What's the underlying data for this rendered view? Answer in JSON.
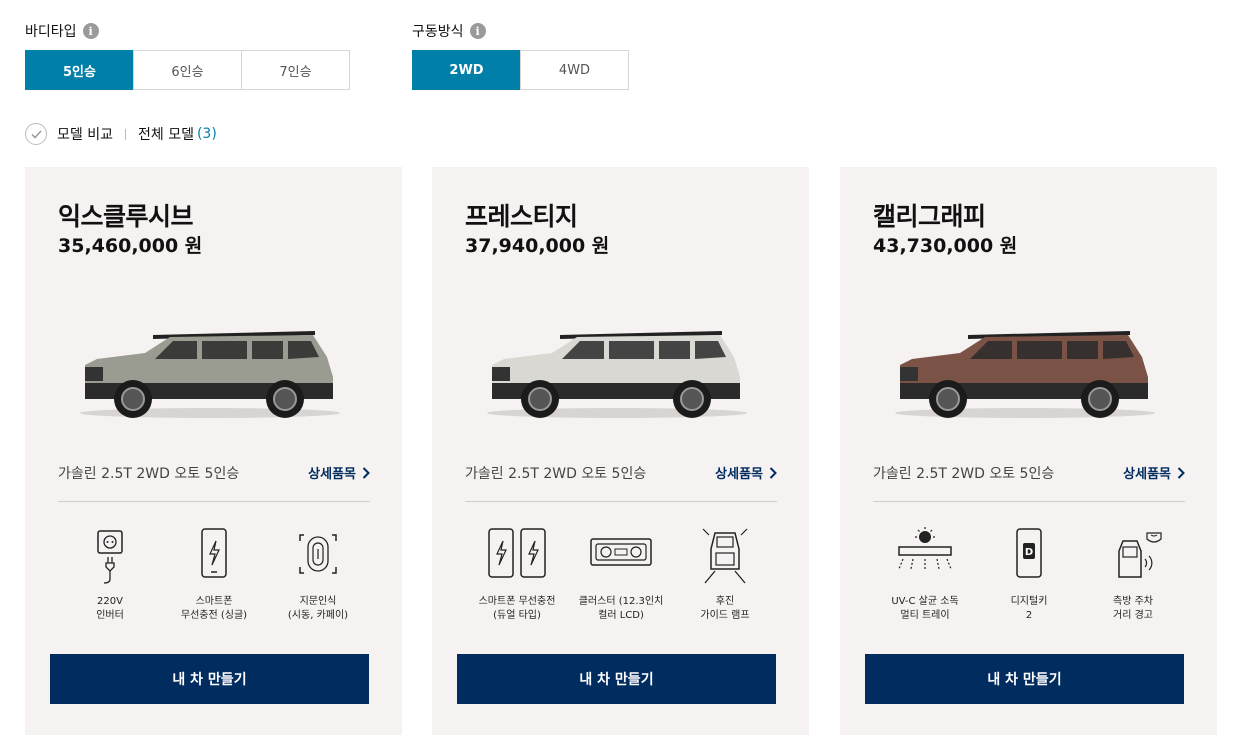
{
  "filters": {
    "body_type": {
      "title": "바디타입",
      "options": [
        "5인승",
        "6인승",
        "7인승"
      ],
      "selected": "5인승"
    },
    "drive": {
      "title": "구동방식",
      "options": [
        "2WD",
        "4WD"
      ],
      "selected": "2WD"
    }
  },
  "compare": {
    "label": "모델 비교",
    "all_label": "전체 모델",
    "count": "(3)"
  },
  "info_glyph": "i",
  "colors": {
    "accent": "#007fa8",
    "navy": "#002c5f",
    "card_bg": "#f5f2f1"
  },
  "cards": [
    {
      "name": "익스클루시브",
      "price": "35,460,000 원",
      "car_color": "#9a9b91",
      "trim": "가솔린 2.5T 2WD 오토 5인승",
      "detail": "상세품목",
      "features": [
        {
          "icon": "outlet-icon",
          "label": "220V\n인버터"
        },
        {
          "icon": "phone-charge-icon",
          "label": "스마트폰\n무선충전 (싱글)"
        },
        {
          "icon": "fingerprint-icon",
          "label": "지문인식\n(시동, 카페이)"
        }
      ],
      "button": "내 차 만들기"
    },
    {
      "name": "프레스티지",
      "price": "37,940,000 원",
      "car_color": "#d9d8d3",
      "trim": "가솔린 2.5T 2WD 오토 5인승",
      "detail": "상세품목",
      "features": [
        {
          "icon": "dual-phone-charge-icon",
          "label": "스마트폰 무선충전\n(듀얼 타입)"
        },
        {
          "icon": "cluster-icon",
          "label": "클러스터 (12.3인치\n컬러 LCD)"
        },
        {
          "icon": "rear-guide-lamp-icon",
          "label": "후진\n가이드 램프"
        }
      ],
      "button": "내 차 만들기"
    },
    {
      "name": "캘리그래피",
      "price": "43,730,000 원",
      "car_color": "#7a5346",
      "trim": "가솔린 2.5T 2WD 오토 5인승",
      "detail": "상세품목",
      "features": [
        {
          "icon": "uv-tray-icon",
          "label": "UV-C 살균 소독\n멀티 트레이"
        },
        {
          "icon": "digital-key-icon",
          "label": "디지털키\n2"
        },
        {
          "icon": "side-parking-warning-icon",
          "label": "측방 주차\n거리 경고"
        }
      ],
      "button": "내 차 만들기"
    }
  ]
}
